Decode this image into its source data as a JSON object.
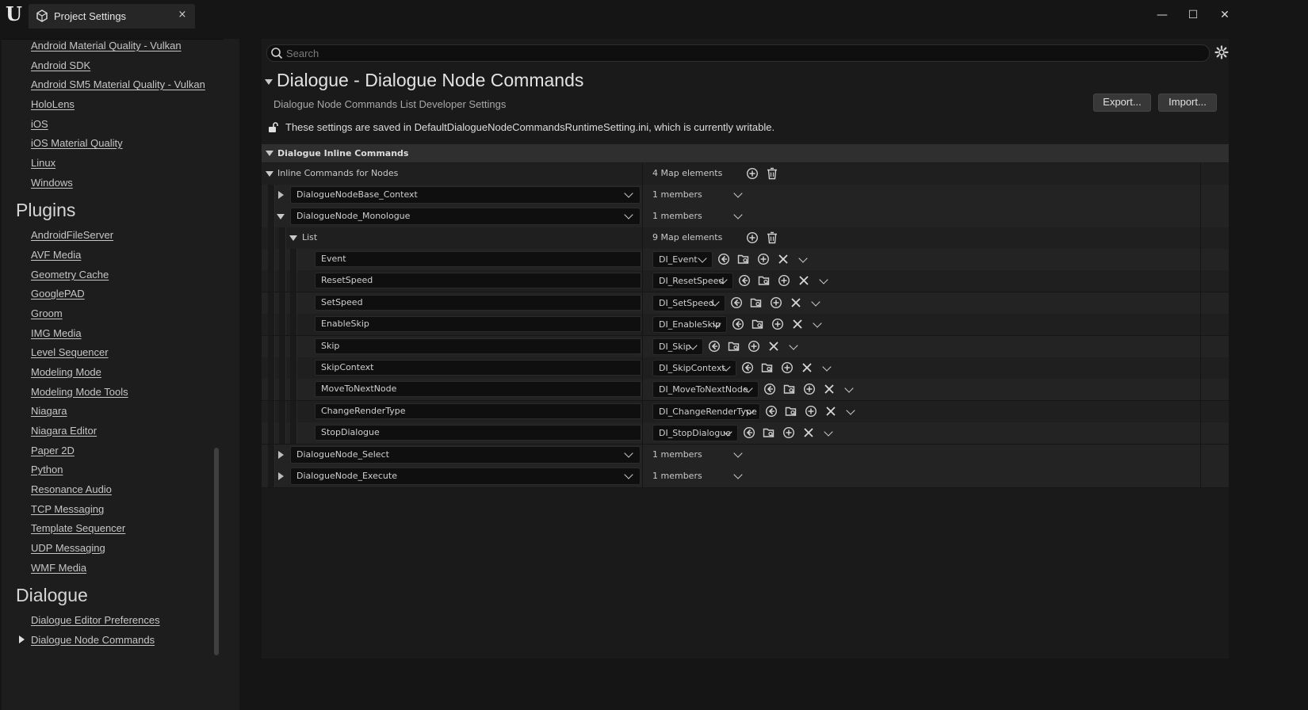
{
  "window": {
    "tab_title": "Project Settings",
    "tab_close_glyph": "×",
    "minimize_glyph": "—",
    "maximize_glyph": "☐",
    "close_glyph": "✕"
  },
  "sidebar": {
    "platform_links": [
      "Android Material Quality - Vulkan",
      "Android SDK",
      "Android SM5 Material Quality - Vulkan",
      "HoloLens",
      "iOS",
      "iOS Material Quality",
      "Linux",
      "Windows"
    ],
    "plugins_heading": "Plugins",
    "plugin_links": [
      "AndroidFileServer",
      "AVF Media",
      "Geometry Cache",
      "GooglePAD",
      "Groom",
      "IMG Media",
      "Level Sequencer",
      "Modeling Mode",
      "Modeling Mode Tools",
      "Niagara",
      "Niagara Editor",
      "Paper 2D",
      "Python",
      "Resonance Audio",
      "TCP Messaging",
      "Template Sequencer",
      "UDP Messaging",
      "WMF Media"
    ],
    "dialogue_heading": "Dialogue",
    "dialogue_links": [
      "Dialogue Editor Preferences",
      "Dialogue Node Commands"
    ]
  },
  "search": {
    "placeholder": "Search"
  },
  "header": {
    "title": "Dialogue - Dialogue Node Commands",
    "subtitle": "Dialogue Node Commands List Developer Settings",
    "export_label": "Export...",
    "import_label": "Import...",
    "saved_note": "These settings are saved in DefaultDialogueNodeCommandsRuntimeSetting.ini, which is currently writable."
  },
  "category": {
    "label": "Dialogue Inline Commands",
    "inline_commands_label": "Inline Commands for Nodes",
    "inline_commands_count": "4 Map elements",
    "nodes": [
      {
        "name": "DialogueNodeBase_Context",
        "members": "1 members"
      },
      {
        "name": "DialogueNode_Monologue",
        "members": "1 members"
      },
      {
        "name": "DialogueNode_Select",
        "members": "1 members"
      },
      {
        "name": "DialogueNode_Execute",
        "members": "1 members"
      }
    ],
    "list_label": "List",
    "list_count": "9 Map elements",
    "entries": [
      {
        "key": "Event",
        "value": "DI_Event"
      },
      {
        "key": "ResetSpeed",
        "value": "DI_ResetSpeed"
      },
      {
        "key": "SetSpeed",
        "value": "DI_SetSpeed"
      },
      {
        "key": "EnableSkip",
        "value": "DI_EnableSkip"
      },
      {
        "key": "Skip",
        "value": "DI_Skip"
      },
      {
        "key": "SkipContext",
        "value": "DI_SkipContext"
      },
      {
        "key": "MoveToNextNode",
        "value": "DI_MoveToNextNode"
      },
      {
        "key": "ChangeRenderType",
        "value": "DI_ChangeRenderType"
      },
      {
        "key": "StopDialogue",
        "value": "DI_StopDialogue"
      }
    ]
  }
}
